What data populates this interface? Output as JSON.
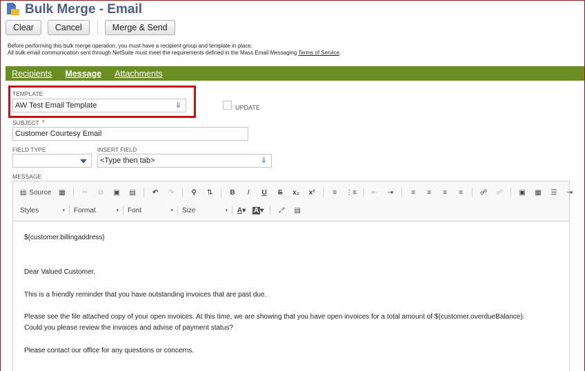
{
  "header": {
    "title": "Bulk Merge - Email",
    "icon": "email-merge-icon"
  },
  "buttons": {
    "clear": "Clear",
    "cancel": "Cancel",
    "merge_send": "Merge & Send"
  },
  "notice": {
    "line1": "Before performing this bulk merge operation, you must have a recipient group and template in place.",
    "line2_prefix": "All bulk email communication sent through NetSuite must meet the requirements defined in the Mass Email Messaging ",
    "line2_link": "Terms of Service",
    "line2_suffix": "."
  },
  "tabs": [
    {
      "label": "Recipients",
      "active": false
    },
    {
      "label": "Message",
      "active": true
    },
    {
      "label": "Attachments",
      "active": false
    }
  ],
  "form": {
    "template_label": "TEMPLATE",
    "template_value": "AW Test Email Template",
    "update_label": "UPDATE",
    "update_checked": false,
    "subject_label": "SUBJECT",
    "subject_value": "Customer Courtesy Email",
    "field_type_label": "FIELD TYPE",
    "field_type_value": "",
    "insert_field_label": "INSERT FIELD",
    "insert_field_value": "<Type then tab>",
    "message_label": "MESSAGE"
  },
  "editor": {
    "toolbar_source": "Source",
    "styles": "Styles",
    "format": "Format",
    "font": "Font",
    "size": "Size",
    "content": {
      "l1": "${customer.billingaddress}",
      "l2": "Dear Valued Customer,",
      "l3": "This is a friendly reminder that you have outstanding invoices that are past due.",
      "l4": "Please see the file attached copy of your open invoices.  At this time, we are showing that you have open invoices for a total amount of  ${customer.overdueBalance}.",
      "l5": "Could you please review the invoices and advise of payment status?",
      "l6": "Please contact our office for any questions or concerns."
    }
  },
  "colors": {
    "tab_bar": "#6b8e23",
    "title": "#4a5f86",
    "highlight": "#c0141a",
    "required": "#d9532c"
  }
}
